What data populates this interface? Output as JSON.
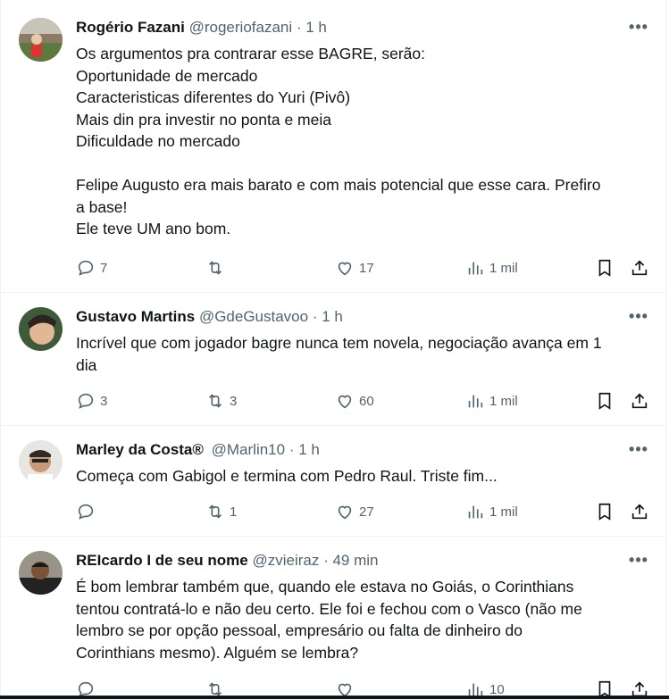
{
  "tweets": [
    {
      "name": "Rogério Fazani",
      "handle": "@rogeriofazani",
      "time": "· 1 h",
      "text": "Os argumentos pra contrarar esse BAGRE, serão:\nOportunidade de mercado\nCaracteristicas diferentes do Yuri (Pivô)\nMais din pra investir no ponta e meia\nDificuldade no mercado\n\nFelipe Augusto era mais barato e com mais potencial que esse cara. Prefiro\na base!\nEle teve UM ano bom.",
      "replies": "7",
      "retweets": "",
      "likes": "17",
      "views": "1 mil"
    },
    {
      "name": "Gustavo Martins",
      "handle": "@GdeGustavoo",
      "time": "· 1 h",
      "text": "Incrível que com jogador bagre nunca tem novela, negociação avança em 1\ndia",
      "replies": "3",
      "retweets": "3",
      "likes": "60",
      "views": "1 mil"
    },
    {
      "name": "Marley da Costa®",
      "handle": "@Marlin10",
      "time": "· 1 h",
      "text": "Começa com Gabigol e termina com Pedro Raul. Triste fim...",
      "replies": "",
      "retweets": "1",
      "likes": "27",
      "views": "1 mil"
    },
    {
      "name": "REIcardo I de seu nome",
      "handle": "@zvieiraz",
      "time": "· 49 min",
      "text": "É bom lembrar também que, quando ele estava no Goiás, o Corinthians\ntentou contratá-lo e não deu certo. Ele foi e fechou com o Vasco (não me\nlembro se por opção pessoal, empresário ou falta de dinheiro do\nCorinthians mesmo). Alguém se lembra?",
      "replies": "",
      "retweets": "",
      "likes": "",
      "views": "10"
    }
  ],
  "icons": {
    "more": "more-icon",
    "reply": "reply-icon",
    "retweet": "retweet-icon",
    "like": "heart-icon",
    "views": "views-icon",
    "bookmark": "bookmark-icon",
    "share": "share-icon"
  },
  "colors": {
    "text": "#0f1419",
    "secondary": "#536471",
    "divider": "#eff3f4"
  }
}
